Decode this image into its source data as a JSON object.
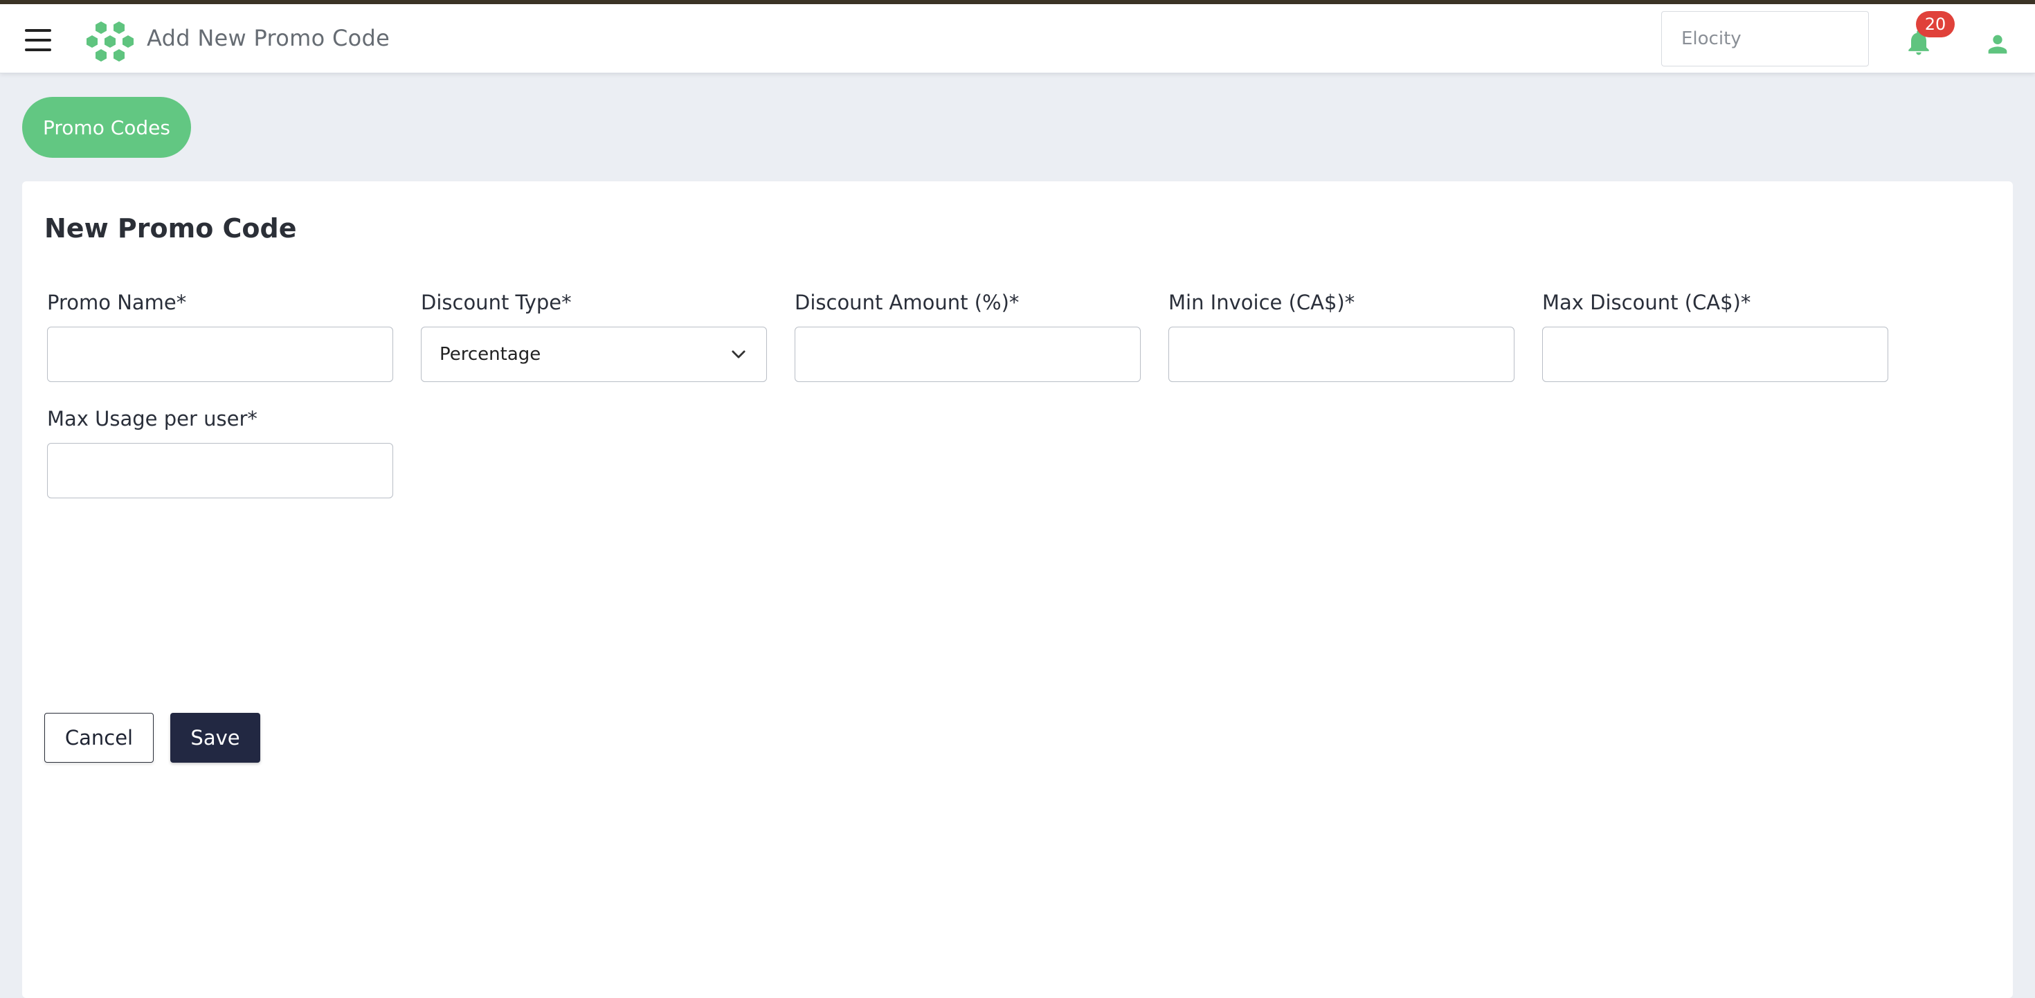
{
  "header": {
    "title": "Add New Promo Code",
    "org_select_value": "Elocity",
    "notifications_count": "20",
    "menu_icon": "hamburger-icon",
    "logo_icon": "hexagon-logo",
    "bell_icon": "bell-icon",
    "user_icon": "user-icon"
  },
  "breadcrumb": {
    "pill_label": "Promo Codes"
  },
  "form": {
    "title": "New Promo Code",
    "fields": {
      "promo_name": {
        "label": "Promo Name*",
        "value": ""
      },
      "discount_type": {
        "label": "Discount Type*",
        "value": "Percentage"
      },
      "discount_amount": {
        "label": "Discount Amount (%)*",
        "value": ""
      },
      "min_invoice": {
        "label": "Min Invoice (CA$)*",
        "value": ""
      },
      "max_discount": {
        "label": "Max Discount (CA$)*",
        "value": ""
      },
      "max_usage": {
        "label": "Max Usage per user*",
        "value": ""
      }
    },
    "cancel_label": "Cancel",
    "save_label": "Save"
  },
  "colors": {
    "accent_green": "#62c782",
    "primary_dark": "#222842",
    "badge_red": "#e0413a",
    "page_bg": "#ebeef3"
  }
}
